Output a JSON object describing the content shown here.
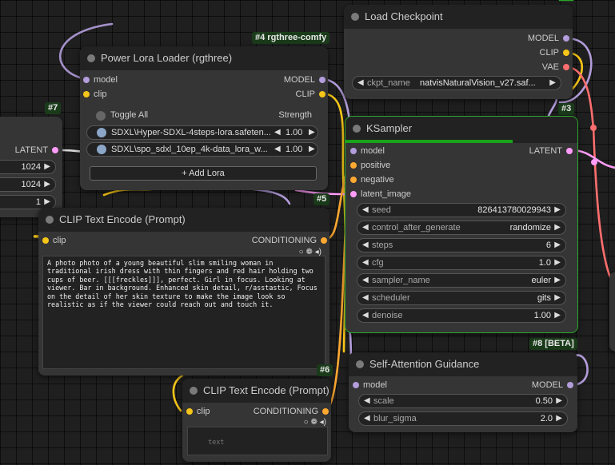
{
  "colors": {
    "model": "#b39ddb",
    "clip": "#f5c518",
    "vae": "#ff6e6e",
    "latent": "#ff9cf9",
    "conditioning": "#ffa931",
    "selected": "#2aa82a"
  },
  "nodes": {
    "empty_latent": {
      "id": "#7",
      "output_latent": "LATENT",
      "width_value": "1024",
      "height_value": "1024",
      "batch_value": "1"
    },
    "power_lora": {
      "id": "#4 rgthree-comfy",
      "title": "Power Lora Loader (rgthree)",
      "in_model": "model",
      "in_clip": "clip",
      "out_model": "MODEL",
      "out_clip": "CLIP",
      "toggle_all": "Toggle All",
      "strength_header": "Strength",
      "loras": [
        {
          "name": "SDXL\\Hyper-SDXL-4steps-lora.safeten...",
          "strength": "1.00"
        },
        {
          "name": "SDXL\\spo_sdxl_10ep_4k-data_lora_w...",
          "strength": "1.00"
        }
      ],
      "add_lora": "+ Add Lora"
    },
    "load_checkpoint": {
      "title": "Load Checkpoint",
      "out_model": "MODEL",
      "out_clip": "CLIP",
      "out_vae": "VAE",
      "ckpt_label": "ckpt_name",
      "ckpt_value": "natvisNaturalVision_v27.saf..."
    },
    "ksampler": {
      "id": "#3",
      "title": "KSampler",
      "progress": 0.72,
      "in_model": "model",
      "in_positive": "positive",
      "in_negative": "negative",
      "in_latent": "latent_image",
      "out_latent": "LATENT",
      "widgets": [
        {
          "label": "seed",
          "value": "826413780029943"
        },
        {
          "label": "control_after_generate",
          "value": "randomize"
        },
        {
          "label": "steps",
          "value": "6"
        },
        {
          "label": "cfg",
          "value": "1.0"
        },
        {
          "label": "sampler_name",
          "value": "euler"
        },
        {
          "label": "scheduler",
          "value": "gits"
        },
        {
          "label": "denoise",
          "value": "1.00"
        }
      ]
    },
    "clip_text_pos": {
      "id": "#5",
      "title": "CLIP Text Encode (Prompt)",
      "in_clip": "clip",
      "out_cond": "CONDITIONING",
      "icons": "○ ❁ ◂)",
      "text": "A photo photo of a young beautiful slim smiling woman in traditional irish dress with thin fingers and red hair holding two cups of beer. [[[freckles]]], perfect. Girl in focus. Looking at viewer. Bar in background. Enhanced skin detail, r/asstastic, Focus on the detail of her skin texture to make the image look so realistic as if the viewer could reach out and touch it."
    },
    "clip_text_neg": {
      "id": "#6",
      "title": "CLIP Text Encode (Prompt)",
      "in_clip": "clip",
      "out_cond": "CONDITIONING",
      "icons": "○ ❁ ◂)",
      "placeholder": "text"
    },
    "self_attention": {
      "id": "#8 [BETA]",
      "title": "Self-Attention Guidance",
      "in_model": "model",
      "out_model": "MODEL",
      "widgets": [
        {
          "label": "scale",
          "value": "0.50"
        },
        {
          "label": "blur_sigma",
          "value": "2.0"
        }
      ]
    }
  }
}
